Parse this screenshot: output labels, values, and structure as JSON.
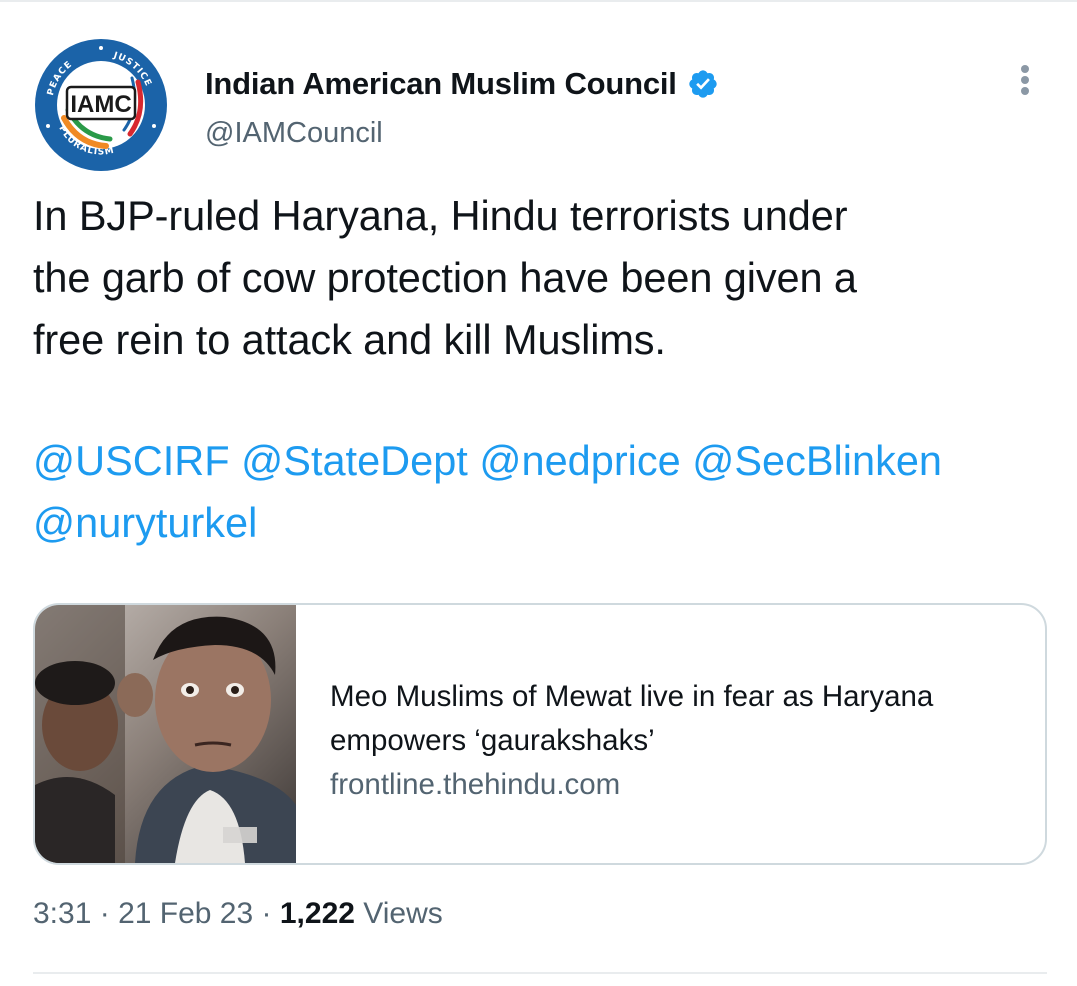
{
  "tweet": {
    "author": {
      "display_name": "Indian American Muslim Council",
      "handle": "@IAMCouncil",
      "verified": true,
      "avatar": {
        "monogram": "IAMC",
        "ring_words": [
          "PEACE",
          "JUSTICE",
          "PLURALISM"
        ],
        "colors": {
          "ring": "#1b63a8",
          "saffron": "#f08a24",
          "green": "#2a9a48",
          "red": "#d8282f"
        }
      }
    },
    "more_icon": "more-vertical-icon",
    "text_lines": [
      "In BJP-ruled Haryana, Hindu terrorists under",
      "the garb of cow protection have been given a",
      "free rein to attack and kill Muslims."
    ],
    "mentions": [
      "@USCIRF",
      "@StateDept",
      "@nedprice",
      "@SecBlinken",
      "@nuryturkel"
    ],
    "link_card": {
      "title_lines": [
        "Meo Muslims of Mewat live in fear as Haryana",
        "empowers ‘gaurakshaks’"
      ],
      "domain": "frontline.thehindu.com",
      "thumbnail": "photo of young men"
    },
    "meta": {
      "time": "3:31",
      "separator": "·",
      "date": "21 Feb 23",
      "views_count": "1,222",
      "views_label": "Views"
    }
  },
  "colors": {
    "link": "#1d9bf0",
    "secondary_text": "#536471",
    "primary_text": "#0f1419",
    "border": "#cfd9de",
    "verified_badge": "#1d9bf0"
  }
}
